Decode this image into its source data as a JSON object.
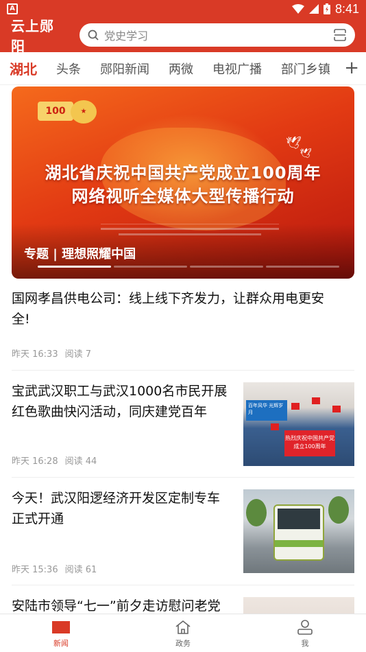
{
  "status_bar": {
    "time": "8:41",
    "left_icon_letter": "A"
  },
  "header": {
    "app_title": "云上郧阳",
    "search_placeholder": "党史学习"
  },
  "tabs": [
    {
      "label": "湖北",
      "active": true
    },
    {
      "label": "头条"
    },
    {
      "label": "郧阳新闻"
    },
    {
      "label": "两微"
    },
    {
      "label": "电视广播"
    },
    {
      "label": "部门乡镇"
    }
  ],
  "banner": {
    "headline_line1": "湖北省庆祝中国共产党成立100周年",
    "headline_line2": "网络视听全媒体大型传播行动",
    "caption": "专题 | 理想照耀中国",
    "logo_text": "100",
    "active_slide": 1,
    "slide_count": 4
  },
  "news": [
    {
      "title": "国网孝昌供电公司：线上线下齐发力，让群众用电更安全!",
      "time": "昨天 16:33",
      "reads": "阅读 7",
      "has_thumb": false
    },
    {
      "title": "宝武武汉职工与武汉1000名市民开展红色歌曲快闪活动，同庆建党百年",
      "time": "昨天 16:28",
      "reads": "阅读 44",
      "has_thumb": true,
      "thumb_texts": {
        "sign": "热烈庆祝中国共产党成立100周年",
        "sign2": "百年风华 光辉岁月"
      }
    },
    {
      "title": "今天！武汉阳逻经济开发区定制专车正式开通",
      "time": "昨天 15:36",
      "reads": "阅读 61",
      "has_thumb": true
    },
    {
      "title": "安陆市领导“七一”前夕走访慰问老党",
      "has_thumb": true
    }
  ],
  "bottom_nav": [
    {
      "label": "新闻",
      "icon": "news-icon",
      "active": true
    },
    {
      "label": "政务",
      "icon": "home-icon"
    },
    {
      "label": "我",
      "icon": "person-icon"
    }
  ],
  "colors": {
    "brand": "#d93a26"
  }
}
